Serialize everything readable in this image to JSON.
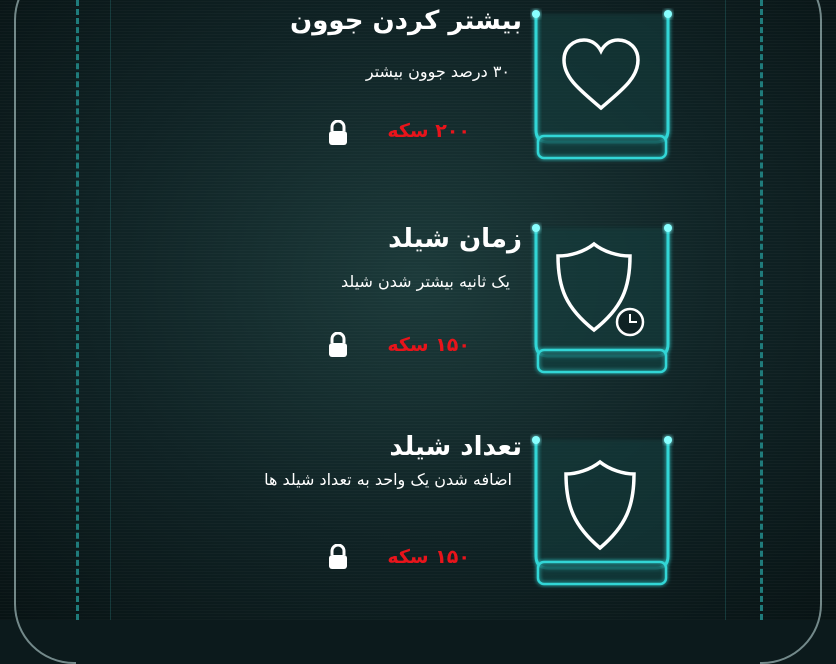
{
  "upgrades": [
    {
      "title": "بیشتر کردن جوون",
      "description": "۳۰ درصد جوون بیشتر",
      "price": "۲۰۰ سکه",
      "icon": "heart-icon",
      "locked": true
    },
    {
      "title": "زمان شیلد",
      "description": "یک ثانیه بیشتر شدن شیلد",
      "price": "۱۵۰ سکه",
      "icon": "shield-timer-icon",
      "locked": true
    },
    {
      "title": "تعداد شیلد",
      "description": "اضافه شدن یک واحد به تعداد شیلد ها",
      "price": "۱۵۰ سکه",
      "icon": "shield-icon",
      "locked": true
    }
  ],
  "colors": {
    "accent": "#31d6d6",
    "price": "#e8141b",
    "text": "#ffffff"
  }
}
